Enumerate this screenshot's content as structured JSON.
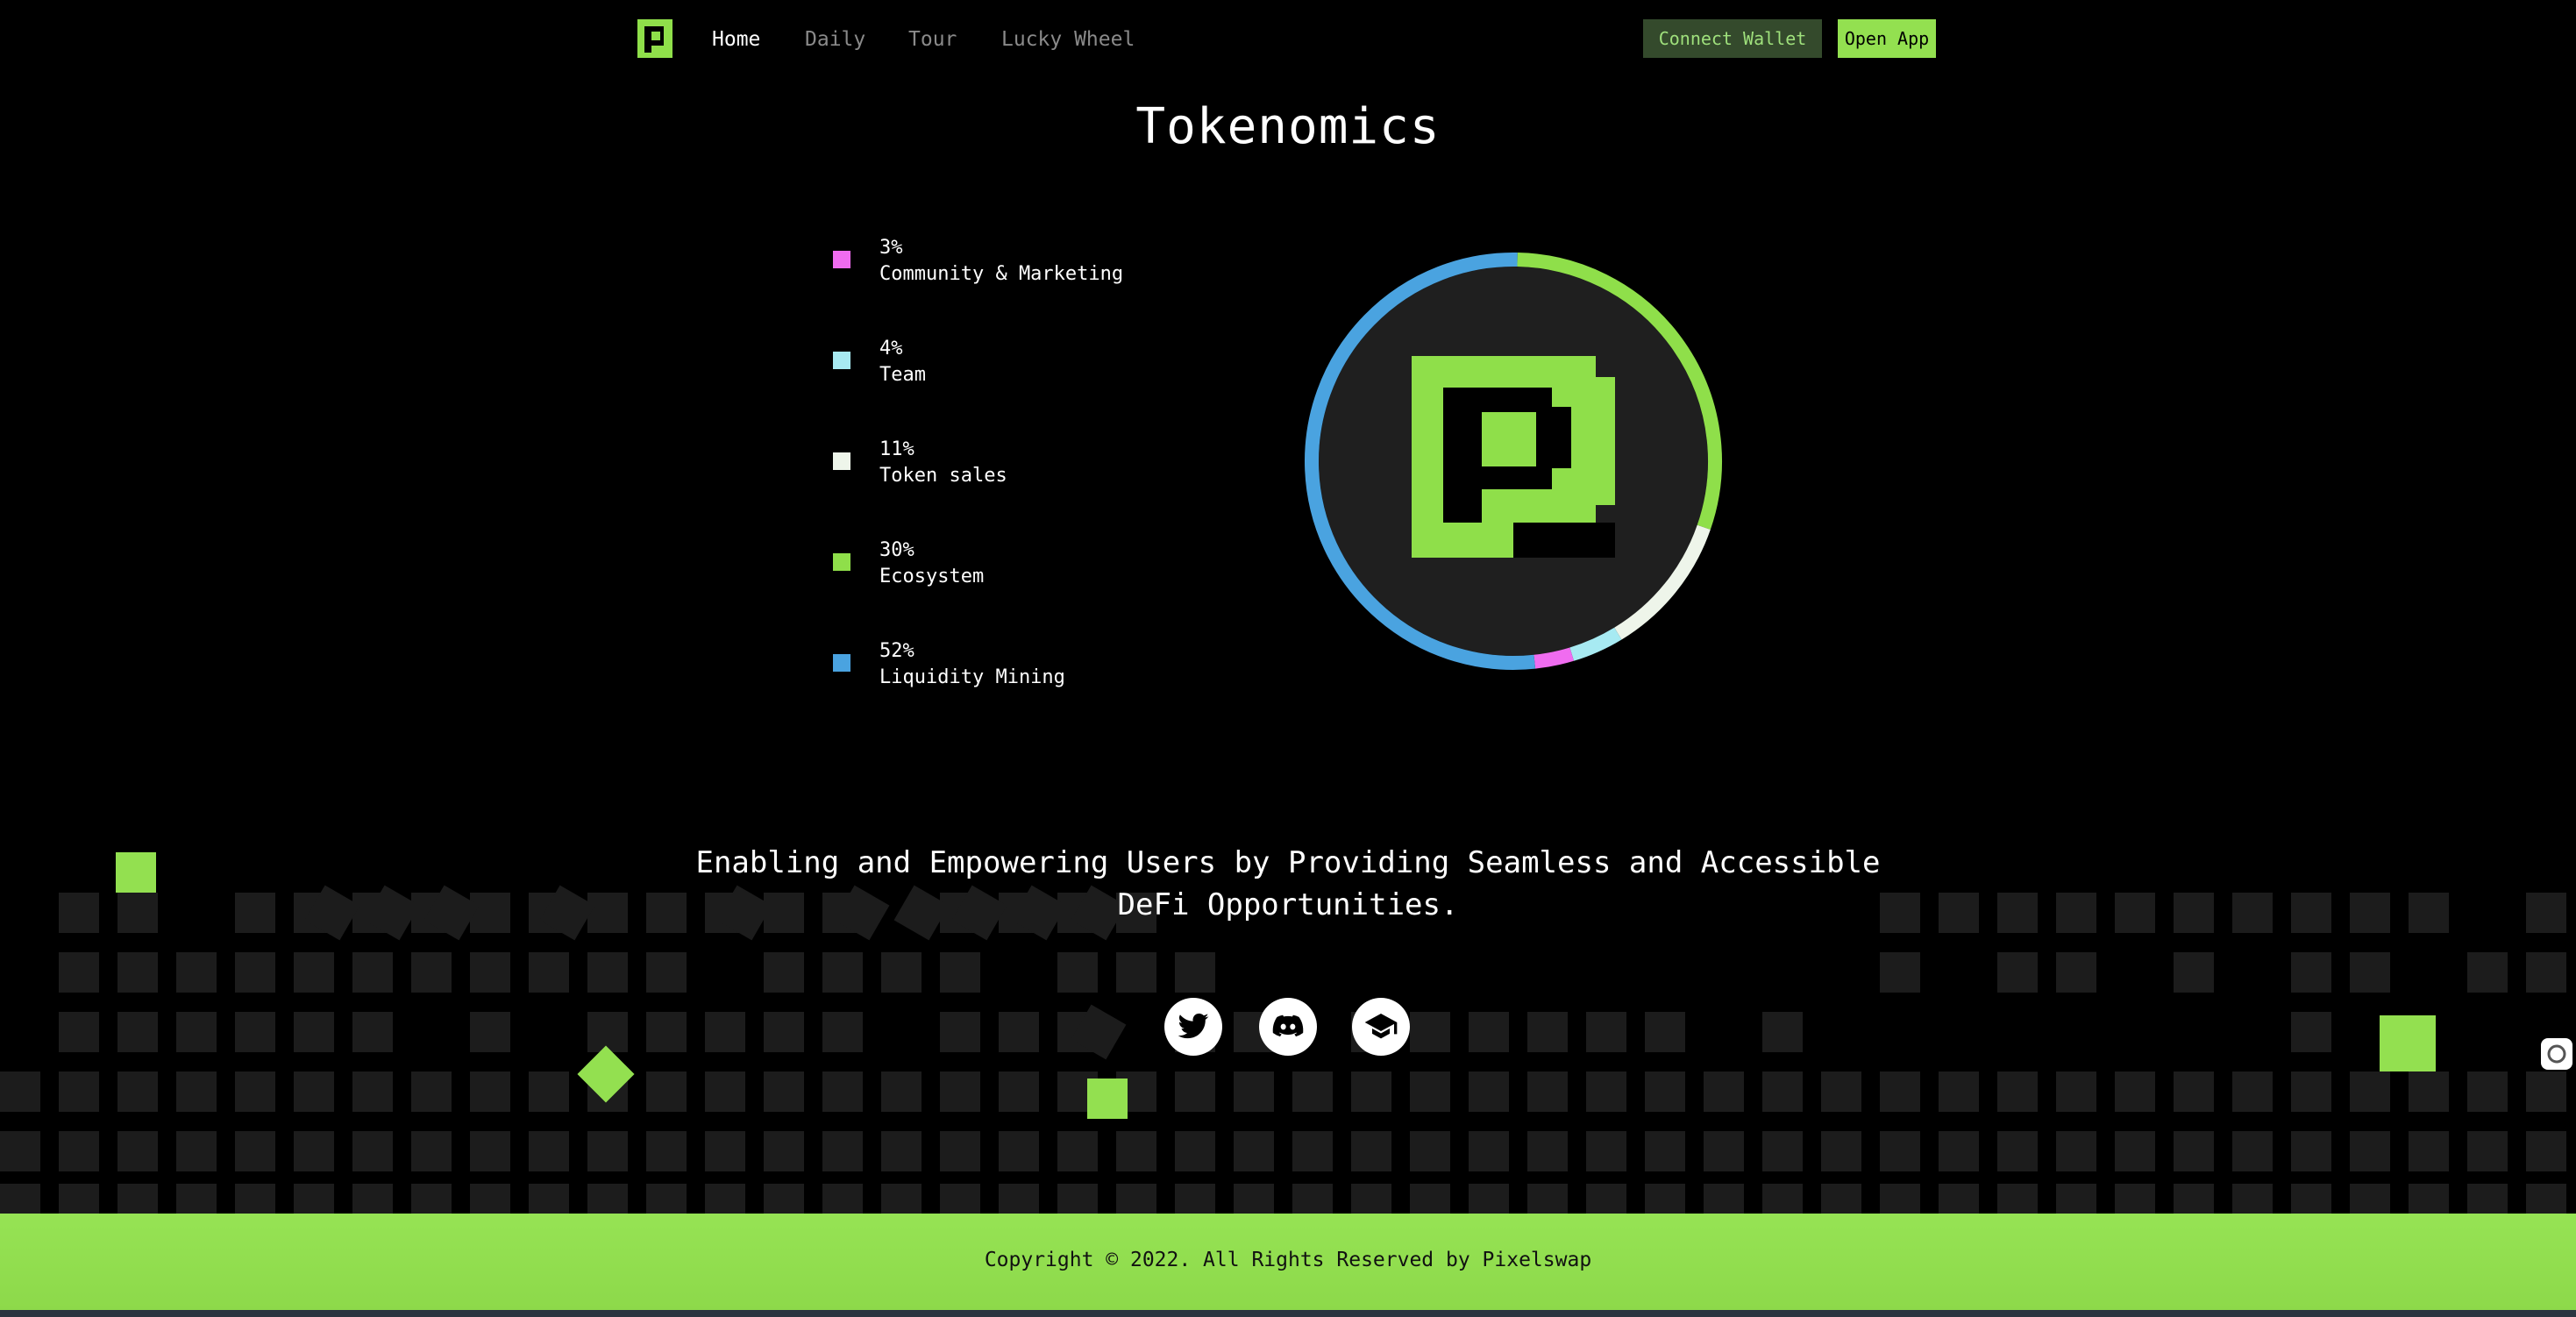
{
  "nav": {
    "logo_icon": "pixelswap-logo-icon",
    "items": [
      {
        "label": "Home",
        "active": true
      },
      {
        "label": "Daily",
        "active": false
      },
      {
        "label": "Tour",
        "active": false
      },
      {
        "label": "Lucky Wheel",
        "active": false
      }
    ],
    "connect_wallet": "Connect Wallet",
    "open_app": "Open App"
  },
  "tokenomics": {
    "title": "Tokenomics",
    "items": [
      {
        "percent": "3%",
        "name": "Community & Marketing",
        "color": "#f06cf0"
      },
      {
        "percent": "4%",
        "name": "Team",
        "color": "#a7eaf2"
      },
      {
        "percent": "11%",
        "name": "Token sales",
        "color": "#eef5ea"
      },
      {
        "percent": "30%",
        "name": "Ecosystem",
        "color": "#8fdf4a"
      },
      {
        "percent": "52%",
        "name": "Liquidity Mining",
        "color": "#4aa3e0"
      }
    ]
  },
  "chart_data": {
    "type": "pie",
    "categories": [
      "Community & Marketing",
      "Team",
      "Token sales",
      "Ecosystem",
      "Liquidity Mining"
    ],
    "values": [
      3,
      4,
      11,
      30,
      52
    ],
    "colors": [
      "#f06cf0",
      "#a7eaf2",
      "#eef5ea",
      "#8fdf4a",
      "#4aa3e0"
    ],
    "title": "Tokenomics",
    "legend": "left"
  },
  "tagline": {
    "line1": "Enabling and Empowering Users by Providing Seamless and Accessible",
    "line2": "DeFi Opportunities."
  },
  "social": [
    {
      "name": "twitter-icon"
    },
    {
      "name": "discord-icon"
    },
    {
      "name": "docs-icon"
    }
  ],
  "footer": {
    "copyright": "Copyright © 2022. All Rights Reserved by Pixelswap"
  },
  "colors": {
    "accent": "#93e050",
    "background": "#000000",
    "tile": "#1c1c1c"
  }
}
